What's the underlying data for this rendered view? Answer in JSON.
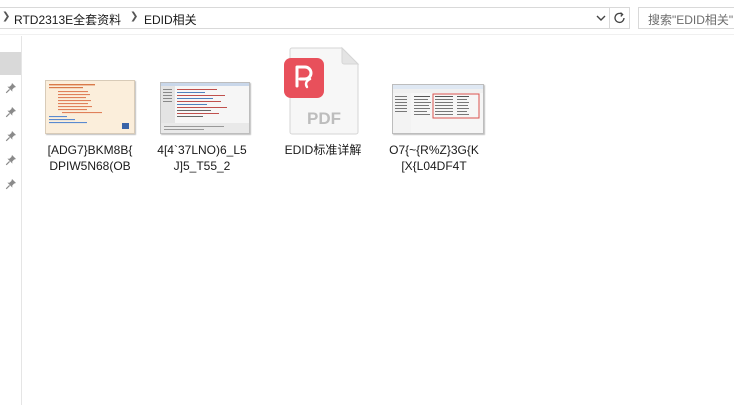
{
  "address_bar": {
    "breadcrumbs": [
      "RTD2313E全套资料",
      "EDID相关"
    ],
    "dropdown_icon": "chevron-down-icon",
    "refresh_icon": "refresh-icon"
  },
  "search": {
    "placeholder": "搜索\"EDID相关\""
  },
  "nav_pane": {
    "pins": [
      "pin-icon",
      "pin-icon",
      "pin-icon",
      "pin-icon",
      "pin-icon"
    ]
  },
  "files": [
    {
      "name": "[ADG7}BKM8B{DPIW5N68(OB",
      "line1": "[ADG7}BKM8B{",
      "line2": "DPIW5N68(OB",
      "type": "image-document"
    },
    {
      "name": "4[4`37LNO)6_L5J]5_T55_2",
      "line1": "4[4`37LNO)6_L5",
      "line2": "J]5_T55_2",
      "type": "image-screenshot"
    },
    {
      "name": "EDID标准详解",
      "line1": "EDID标准详解",
      "line2": "",
      "type": "pdf",
      "icon_text": "PDF",
      "brand_color": "#e8505b"
    },
    {
      "name": "O7{~{R%Z}3G{K[X{L04DF4T",
      "line1": "O7{~{R%Z}3G{K",
      "line2": "[X{L04DF4T",
      "type": "image-screenshot"
    }
  ]
}
